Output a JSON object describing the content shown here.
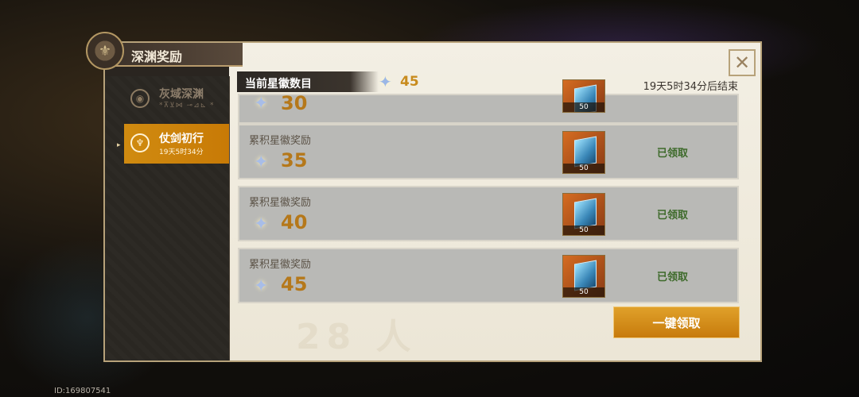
{
  "header": {
    "title": "深渊奖励"
  },
  "sidebar": {
    "items": [
      {
        "label": "灰域深渊",
        "sub": "*⊼⊻⋈ ⊸⊿⊾ *",
        "active": false
      },
      {
        "label": "仗剑初行",
        "sub": "19天5时34分",
        "active": true
      }
    ]
  },
  "stars": {
    "label": "当前星徽数目",
    "value": "45"
  },
  "timer": "19天5时34分后结束",
  "rewards": [
    {
      "label": "",
      "stars": "30",
      "item_count": "50",
      "status": ""
    },
    {
      "label": "累积星徽奖励",
      "stars": "35",
      "item_count": "50",
      "status": "已领取"
    },
    {
      "label": "累积星徽奖励",
      "stars": "40",
      "item_count": "50",
      "status": "已领取"
    },
    {
      "label": "累积星徽奖励",
      "stars": "45",
      "item_count": "50",
      "status": "已领取"
    }
  ],
  "claim_all": "一键领取",
  "watermark": "28 人",
  "footer_id": "ID:169807541",
  "colors": {
    "accent": "#c87a06",
    "claimed": "#3d6a2a",
    "star_value": "#c88b1d"
  }
}
